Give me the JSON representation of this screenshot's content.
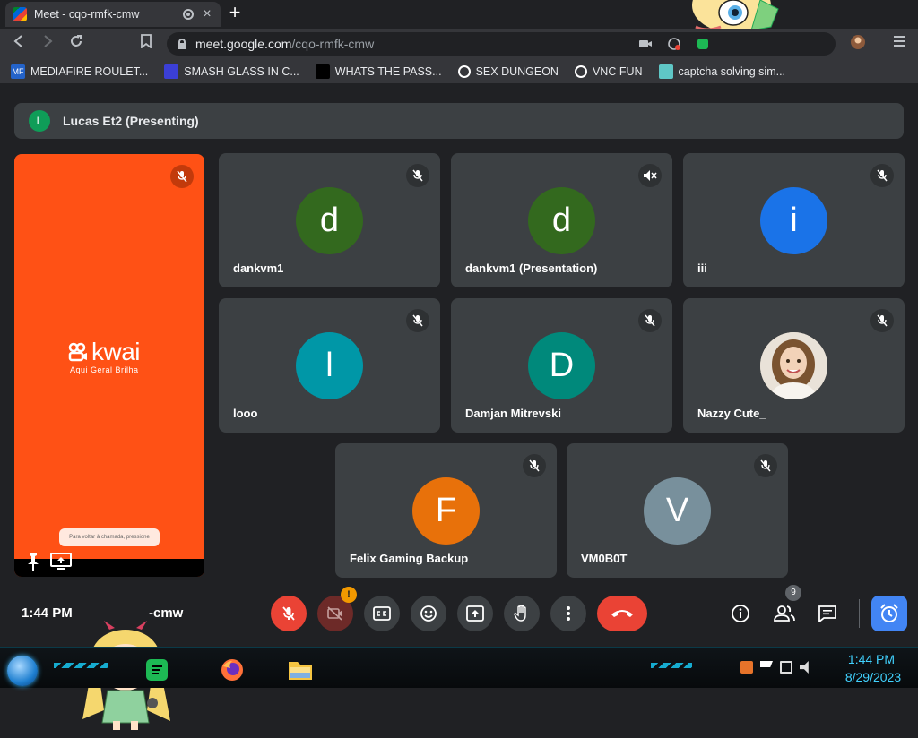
{
  "browser": {
    "tab_title": "Meet - cqo-rmfk-cmw",
    "url_host": "meet.google.com",
    "url_path": "/cqo-rmfk-cmw"
  },
  "bookmarks": [
    {
      "label": "MEDIAFIRE ROULET...",
      "icon": "MF",
      "color": "#2463c9"
    },
    {
      "label": "SMASH GLASS IN C...",
      "icon": "",
      "color": "#3b3fd6"
    },
    {
      "label": "WHATS THE PASS...",
      "icon": "",
      "color": "#000000"
    },
    {
      "label": "SEX DUNGEON",
      "icon": "",
      "color": "#ffffff"
    },
    {
      "label": "VNC FUN",
      "icon": "",
      "color": "#ffffff"
    },
    {
      "label": "captcha solving sim...",
      "icon": "",
      "color": "#5fc7c6"
    }
  ],
  "meet": {
    "presenter_initial": "L",
    "presenter_label": "Lucas Et2 (Presenting)",
    "share": {
      "brand": "kwai",
      "tagline": "Aqui Geral Brilha",
      "toast": "Para voltar à chamada, pressione"
    },
    "tiles": [
      {
        "name": "dankvm1",
        "initial": "d",
        "color": "#33691e"
      },
      {
        "name": "dankvm1 (Presentation)",
        "initial": "d",
        "color": "#33691e"
      },
      {
        "name": "iii",
        "initial": "i",
        "color": "#1a73e8"
      },
      {
        "name": "looo",
        "initial": "l",
        "color": "#0097a7"
      },
      {
        "name": "Damjan Mitrevski",
        "initial": "D",
        "color": "#00897b"
      },
      {
        "name": "Nazzy Cute_",
        "initial": "",
        "color": "#d8c6b4"
      },
      {
        "name": "Felix Gaming Backup",
        "initial": "F",
        "color": "#e8710a"
      },
      {
        "name": "VM0B0T",
        "initial": "V",
        "color": "#78909c"
      }
    ],
    "clock": "1:44 PM",
    "meeting_code": "-cmw",
    "warning_badge": "!",
    "people_count": "9"
  },
  "taskbar": {
    "time": "1:44 PM",
    "date": "8/29/2023"
  },
  "icons": {
    "mic_off": "mic-off-icon",
    "cam_off": "camera-off-icon",
    "captions": "captions-icon",
    "emoji": "emoji-icon",
    "present": "present-icon",
    "hand": "raise-hand-icon",
    "more": "more-vert-icon",
    "hangup": "hangup-icon",
    "info": "info-icon",
    "people": "people-icon",
    "chat": "chat-icon",
    "activities": "activities-icon"
  },
  "colors": {
    "meet_bg": "#202124",
    "tile_bg": "#3c4043",
    "red": "#ea4335",
    "accent_blue": "#4285f4",
    "share_orange": "#ff5115"
  }
}
